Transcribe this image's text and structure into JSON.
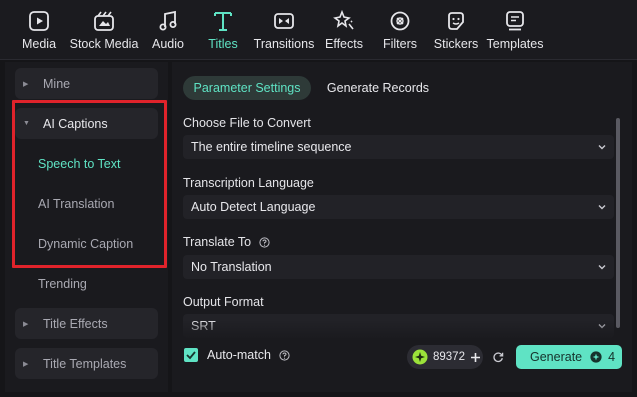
{
  "toolbar": {
    "items": [
      {
        "label": "Media",
        "icon": "media-icon",
        "active": false
      },
      {
        "label": "Stock Media",
        "icon": "stock-media-icon",
        "active": false
      },
      {
        "label": "Audio",
        "icon": "music-note-icon",
        "active": false
      },
      {
        "label": "Titles",
        "icon": "titles-icon",
        "active": true
      },
      {
        "label": "Transitions",
        "icon": "transitions-icon",
        "active": false
      },
      {
        "label": "Effects",
        "icon": "effects-icon",
        "active": false
      },
      {
        "label": "Filters",
        "icon": "filters-icon",
        "active": false
      },
      {
        "label": "Stickers",
        "icon": "stickers-icon",
        "active": false
      },
      {
        "label": "Templates",
        "icon": "templates-icon",
        "active": false
      }
    ]
  },
  "sidebar": {
    "items": [
      {
        "label": "Mine",
        "caret": "▶"
      },
      {
        "label": "AI Captions",
        "caret": "▼"
      },
      {
        "label": "Speech to Text"
      },
      {
        "label": "AI Translation"
      },
      {
        "label": "Dynamic Caption"
      },
      {
        "label": "Trending"
      },
      {
        "label": "Title Effects",
        "caret": "▶"
      },
      {
        "label": "Title Templates",
        "caret": "▶"
      }
    ]
  },
  "panel": {
    "tabs": [
      {
        "label": "Parameter Settings",
        "active": true
      },
      {
        "label": "Generate Records",
        "active": false
      }
    ],
    "fields": [
      {
        "label": "Choose File to Convert",
        "value": "The entire timeline sequence"
      },
      {
        "label": "Transcription Language",
        "value": "Auto Detect Language"
      },
      {
        "label": "Translate To",
        "value": "No Translation"
      },
      {
        "label": "Output Format",
        "value": "SRT"
      }
    ],
    "auto_match": {
      "label": "Auto-match",
      "checked": true
    },
    "credits": "89372",
    "generate": {
      "label": "Generate",
      "cost": "4"
    }
  },
  "colors": {
    "accent": "#5fe3c4",
    "highlight_box": "#e0232b",
    "background": "#151518",
    "panel": "#1a1a1e"
  }
}
